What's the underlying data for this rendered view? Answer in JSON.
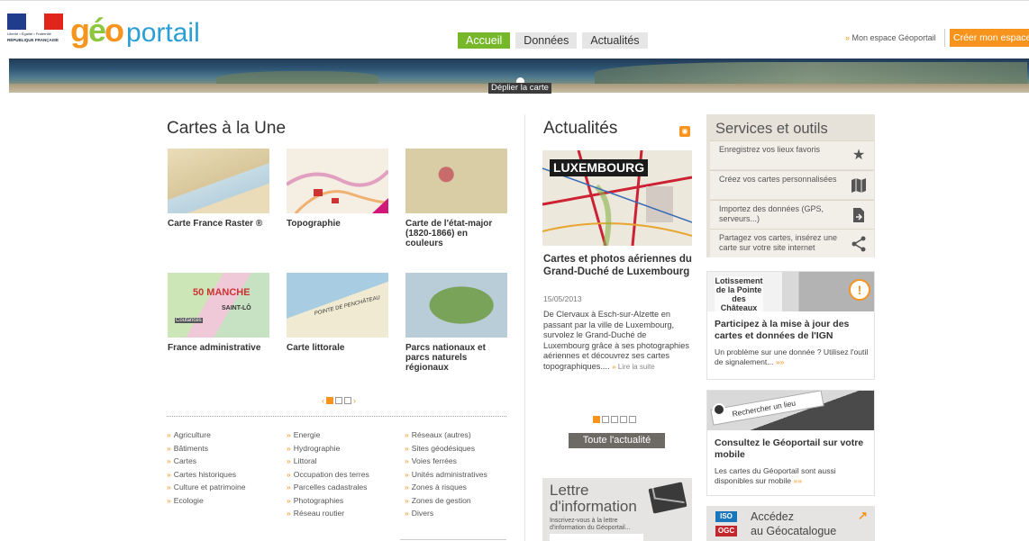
{
  "header": {
    "flag_motto": "Liberté • Égalité • Fraternité",
    "flag_republic": "RÉPUBLIQUE FRANÇAISE",
    "logo": {
      "geo": "géo",
      "portail": "portail"
    },
    "nav": [
      {
        "label": "Accueil",
        "active": true
      },
      {
        "label": "Données",
        "active": false
      },
      {
        "label": "Actualités",
        "active": false
      }
    ],
    "my_space": "Mon espace Géoportail",
    "create_account": "Créer mon espace"
  },
  "map_banner": {
    "unfold_label": "Déplier la carte"
  },
  "featured": {
    "title": "Cartes à la Une",
    "cards": [
      {
        "caption": "Carte France Raster ®"
      },
      {
        "caption": "Topographie"
      },
      {
        "caption": "Carte de l'état-major (1820-1866) en couleurs"
      },
      {
        "caption": "France administrative"
      },
      {
        "caption": "Carte littorale"
      },
      {
        "caption": "Parcs nationaux et parcs naturels régionaux"
      }
    ],
    "thumb_labels": {
      "manche": "50 MANCHE",
      "saint_lo": "SAINT-LÔ",
      "coutances": "Coutances",
      "penchateau": "POINTE DE PENCHÂTEAU"
    },
    "pager": {
      "prev": "‹",
      "next": "›",
      "pages": 3,
      "current": 1
    }
  },
  "themes": {
    "col1": [
      "Agriculture",
      "Bâtiments",
      "Cartes",
      "Cartes historiques",
      "Culture et patrimoine",
      "Ecologie"
    ],
    "col2": [
      "Energie",
      "Hydrographie",
      "Littoral",
      "Occupation des terres",
      "Parcelles cadastrales",
      "Photographies",
      "Réseau routier"
    ],
    "col3": [
      "Réseaux (autres)",
      "Sites géodésiques",
      "Voies ferrées",
      "Unités administratives",
      "Zones à risques",
      "Zones de gestion",
      "Divers"
    ]
  },
  "news": {
    "title": "Actualités",
    "image_label": "LUXEMBOURG",
    "headline": "Cartes et photos aériennes du Grand-Duché de Luxembourg",
    "date": "15/05/2013",
    "body": "De Clervaux à Esch-sur-Alzette en passant par la ville de Luxembourg, survolez le Grand-Duché de Luxembourg grâce à ses photographies aériennes et découvrez ses cartes topographiques....",
    "more": "Lire la suite",
    "pager": {
      "pages": 5,
      "current": 1
    },
    "all_news": "Toute l'actualité"
  },
  "newsletter": {
    "title_line1": "Lettre",
    "title_line2": "d'information",
    "desc": "Inscrivez-vous à la lettre d'information du Géoportail..."
  },
  "services": {
    "title": "Services et outils",
    "items": [
      {
        "label": "Enregistrez vos lieux favoris",
        "icon": "star-icon"
      },
      {
        "label": "Créez vos cartes personnalisées",
        "icon": "map-icon"
      },
      {
        "label": "Importez des données (GPS, serveurs...)",
        "icon": "file-import-icon"
      },
      {
        "label": "Partagez vos cartes, insérez une carte sur votre site internet",
        "icon": "share-icon"
      }
    ]
  },
  "report_card": {
    "image_label": "Lotissement de la Pointe des Châteaux",
    "title": "Participez à la mise à jour des cartes et données de l'IGN",
    "desc": "Un problème sur une donnée ? Utilisez l'outil de signalement...",
    "arrows": "»»"
  },
  "mobile_card": {
    "search_label": "Rechercher un lieu",
    "title": "Consultez le Géoportail sur votre mobile",
    "desc": "Les cartes du Géoportail sont aussi disponibles sur mobile",
    "arrows": "»»"
  },
  "catalog_card": {
    "iso": "ISO",
    "ogc": "OGC",
    "line1": "Accédez",
    "line2": "au Géocatalogue",
    "arrow": "↗"
  },
  "colors": {
    "accent": "#f7941d",
    "green": "#76b82a",
    "blue": "#2a9fd6"
  }
}
